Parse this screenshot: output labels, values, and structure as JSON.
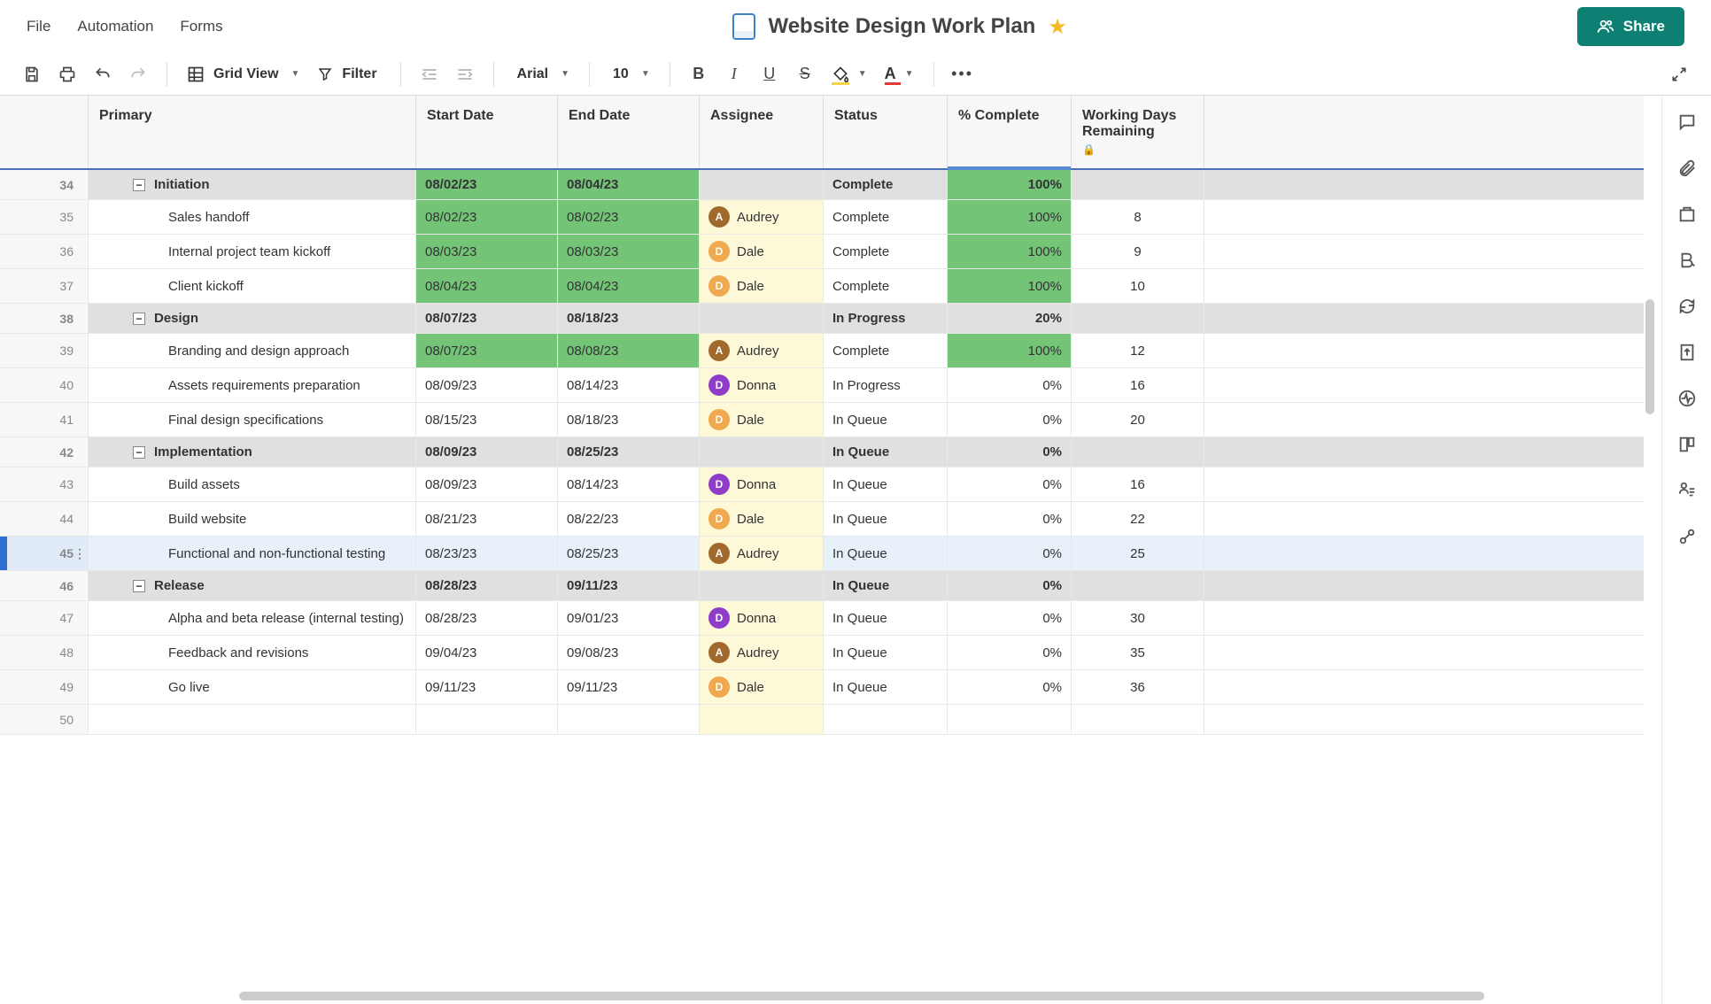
{
  "menu": {
    "file": "File",
    "automation": "Automation",
    "forms": "Forms"
  },
  "header": {
    "title": "Website Design Work Plan",
    "share": "Share"
  },
  "toolbar": {
    "view": "Grid View",
    "filter": "Filter",
    "font": "Arial",
    "fontsize": "10"
  },
  "columns": {
    "primary": "Primary",
    "start": "Start Date",
    "end": "End Date",
    "assignee": "Assignee",
    "status": "Status",
    "pct": "% Complete",
    "wdays": "Working Days Remaining"
  },
  "assigneeColors": {
    "Audrey": "audrey",
    "Dale": "dale",
    "Donna": "donna"
  },
  "rows": [
    {
      "num": 34,
      "type": "summary",
      "label": "Initiation",
      "start": "08/02/23",
      "end": "08/04/23",
      "startGreen": true,
      "endGreen": true,
      "assignee": "",
      "status": "Complete",
      "pct": "100%",
      "pctGreen": true,
      "wdays": ""
    },
    {
      "num": 35,
      "type": "task",
      "label": "Sales handoff",
      "start": "08/02/23",
      "end": "08/02/23",
      "startGreen": true,
      "endGreen": true,
      "assignee": "Audrey",
      "status": "Complete",
      "pct": "100%",
      "pctGreen": true,
      "wdays": "8"
    },
    {
      "num": 36,
      "type": "task",
      "label": "Internal project team kickoff",
      "start": "08/03/23",
      "end": "08/03/23",
      "startGreen": true,
      "endGreen": true,
      "assignee": "Dale",
      "status": "Complete",
      "pct": "100%",
      "pctGreen": true,
      "wdays": "9"
    },
    {
      "num": 37,
      "type": "task",
      "label": "Client kickoff",
      "start": "08/04/23",
      "end": "08/04/23",
      "startGreen": true,
      "endGreen": true,
      "assignee": "Dale",
      "status": "Complete",
      "pct": "100%",
      "pctGreen": true,
      "wdays": "10"
    },
    {
      "num": 38,
      "type": "summary",
      "label": "Design",
      "start": "08/07/23",
      "end": "08/18/23",
      "startGreen": false,
      "endGreen": false,
      "assignee": "",
      "status": "In Progress",
      "pct": "20%",
      "pctGreen": false,
      "wdays": ""
    },
    {
      "num": 39,
      "type": "task",
      "label": "Branding and design approach",
      "start": "08/07/23",
      "end": "08/08/23",
      "startGreen": true,
      "endGreen": true,
      "assignee": "Audrey",
      "status": "Complete",
      "pct": "100%",
      "pctGreen": true,
      "wdays": "12"
    },
    {
      "num": 40,
      "type": "task",
      "label": "Assets requirements preparation",
      "start": "08/09/23",
      "end": "08/14/23",
      "startGreen": false,
      "endGreen": false,
      "assignee": "Donna",
      "status": "In Progress",
      "pct": "0%",
      "pctGreen": false,
      "wdays": "16"
    },
    {
      "num": 41,
      "type": "task",
      "label": "Final design specifications",
      "start": "08/15/23",
      "end": "08/18/23",
      "startGreen": false,
      "endGreen": false,
      "assignee": "Dale",
      "status": "In Queue",
      "pct": "0%",
      "pctGreen": false,
      "wdays": "20"
    },
    {
      "num": 42,
      "type": "summary",
      "label": "Implementation",
      "start": "08/09/23",
      "end": "08/25/23",
      "startGreen": false,
      "endGreen": false,
      "assignee": "",
      "status": "In Queue",
      "pct": "0%",
      "pctGreen": false,
      "wdays": ""
    },
    {
      "num": 43,
      "type": "task",
      "label": "Build assets",
      "start": "08/09/23",
      "end": "08/14/23",
      "startGreen": false,
      "endGreen": false,
      "assignee": "Donna",
      "status": "In Queue",
      "pct": "0%",
      "pctGreen": false,
      "wdays": "16"
    },
    {
      "num": 44,
      "type": "task",
      "label": "Build website",
      "start": "08/21/23",
      "end": "08/22/23",
      "startGreen": false,
      "endGreen": false,
      "assignee": "Dale",
      "status": "In Queue",
      "pct": "0%",
      "pctGreen": false,
      "wdays": "22"
    },
    {
      "num": 45,
      "type": "task",
      "selected": true,
      "label": "Functional and non-functional testing",
      "start": "08/23/23",
      "end": "08/25/23",
      "startGreen": false,
      "endGreen": false,
      "assignee": "Audrey",
      "status": "In Queue",
      "pct": "0%",
      "pctGreen": false,
      "wdays": "25"
    },
    {
      "num": 46,
      "type": "summary",
      "label": "Release",
      "start": "08/28/23",
      "end": "09/11/23",
      "startGreen": false,
      "endGreen": false,
      "assignee": "",
      "status": "In Queue",
      "pct": "0%",
      "pctGreen": false,
      "wdays": ""
    },
    {
      "num": 47,
      "type": "task",
      "label": "Alpha and beta release (internal testing)",
      "start": "08/28/23",
      "end": "09/01/23",
      "startGreen": false,
      "endGreen": false,
      "assignee": "Donna",
      "status": "In Queue",
      "pct": "0%",
      "pctGreen": false,
      "wdays": "30"
    },
    {
      "num": 48,
      "type": "task",
      "label": "Feedback and revisions",
      "start": "09/04/23",
      "end": "09/08/23",
      "startGreen": false,
      "endGreen": false,
      "assignee": "Audrey",
      "status": "In Queue",
      "pct": "0%",
      "pctGreen": false,
      "wdays": "35"
    },
    {
      "num": 49,
      "type": "task",
      "label": "Go live",
      "start": "09/11/23",
      "end": "09/11/23",
      "startGreen": false,
      "endGreen": false,
      "assignee": "Dale",
      "status": "In Queue",
      "pct": "0%",
      "pctGreen": false,
      "wdays": "36"
    },
    {
      "num": 50,
      "type": "empty"
    }
  ]
}
